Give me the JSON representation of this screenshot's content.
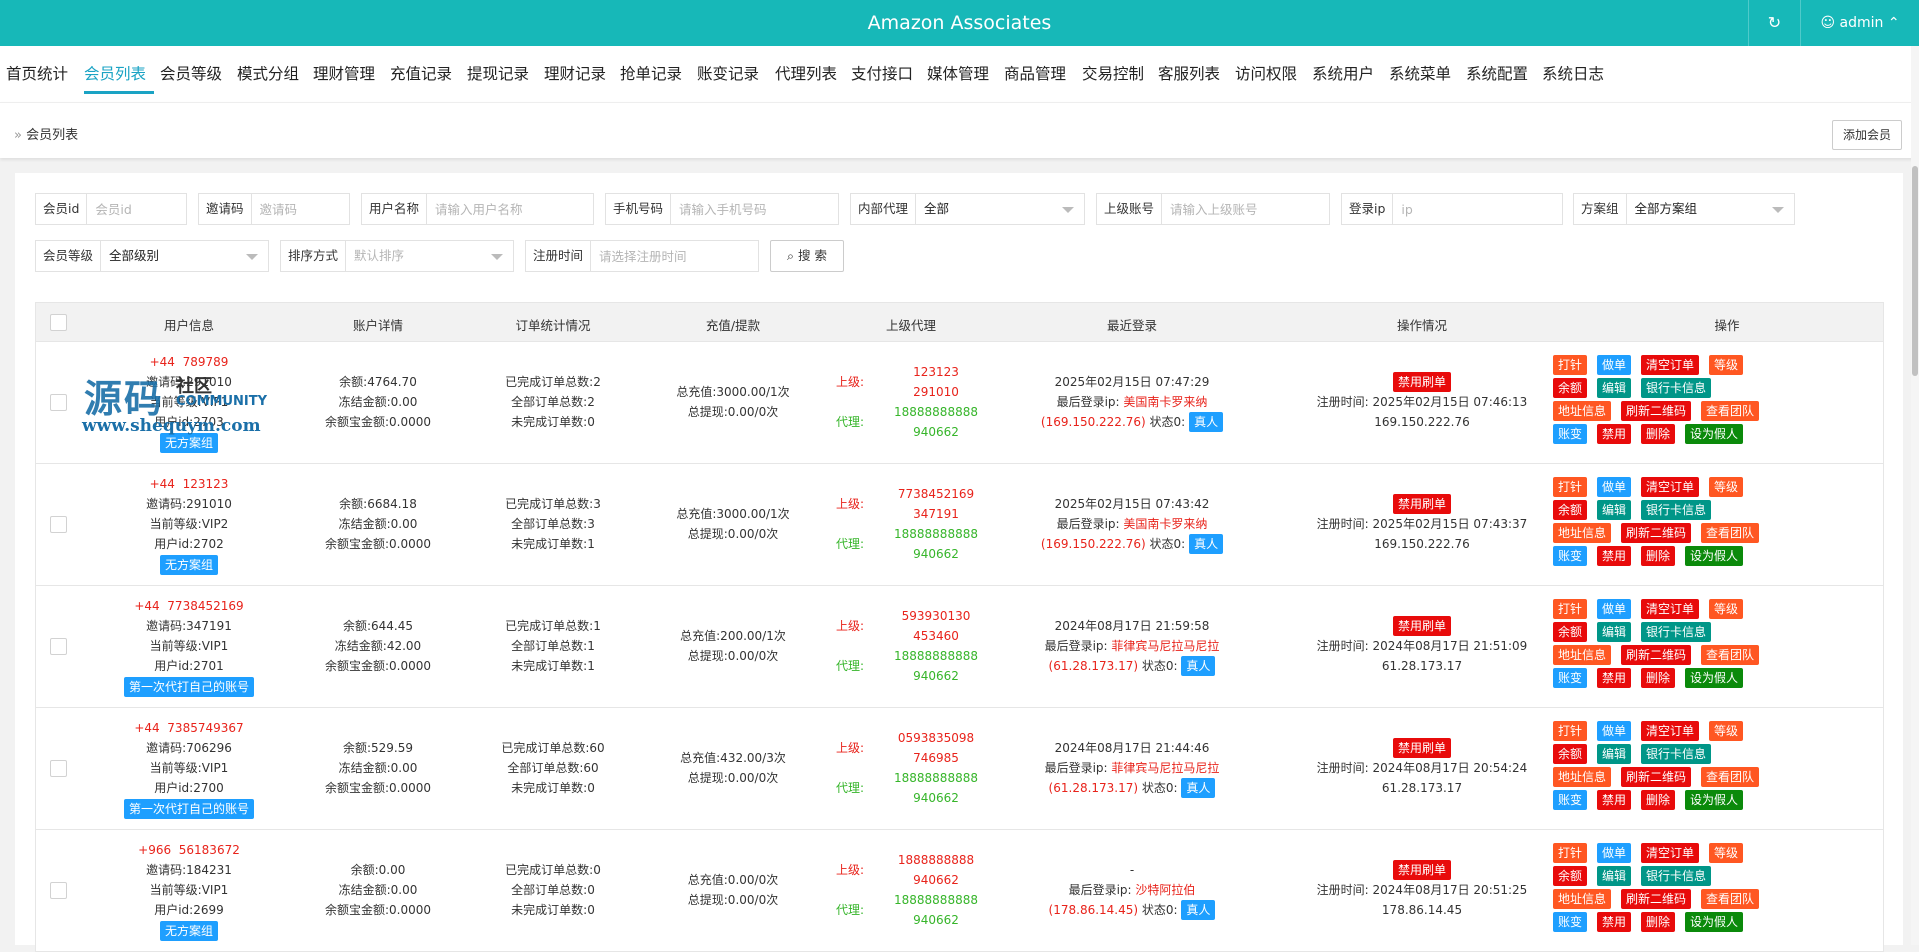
{
  "header": {
    "title": "Amazon Associates",
    "refresh_icon": "refresh-icon",
    "user": "admin"
  },
  "nav": {
    "items": [
      "首页统计",
      "会员列表",
      "会员等级",
      "模式分组",
      "理财管理",
      "充值记录",
      "提现记录",
      "理财记录",
      "抢单记录",
      "账变记录",
      "代理列表",
      "支付接口",
      "媒体管理",
      "商品管理",
      "交易控制",
      "客服列表",
      "访问权限",
      "系统用户",
      "系统菜单",
      "系统配置",
      "系统日志"
    ],
    "active": "会员列表"
  },
  "breadcrumb": {
    "label": "会员列表"
  },
  "add_button": "添加会员",
  "filters": {
    "member_id": {
      "label": "会员id",
      "placeholder": "会员id"
    },
    "invite_code": {
      "label": "邀请码",
      "placeholder": "邀请码"
    },
    "username": {
      "label": "用户名称",
      "placeholder": "请输入用户名称"
    },
    "phone": {
      "label": "手机号码",
      "placeholder": "请输入手机号码"
    },
    "internal_agent": {
      "label": "内部代理",
      "value": "全部"
    },
    "parent_account": {
      "label": "上级账号",
      "placeholder": "请输入上级账号"
    },
    "login_ip": {
      "label": "登录ip",
      "placeholder": "ip"
    },
    "plan_group": {
      "label": "方案组",
      "value": "全部方案组"
    },
    "member_level": {
      "label": "会员等级",
      "value": "全部级别"
    },
    "sort": {
      "label": "排序方式",
      "value": "默认排序"
    },
    "reg_time": {
      "label": "注册时间",
      "placeholder": "请选择注册时间"
    },
    "search_button": "搜 索"
  },
  "table": {
    "headers": [
      "用户信息",
      "账户详情",
      "订单统计情况",
      "充值/提款",
      "上级代理",
      "最近登录",
      "操作情况",
      "操作"
    ],
    "rows": [
      {
        "phone_prefix": "+44",
        "phone": "789789",
        "invite": "邀请码:291010",
        "level": "当前等级:VIP1",
        "uid": "用户id:2703",
        "tag": "无方案组",
        "balance": "余额:4764.70",
        "frozen": "冻结金额:0.00",
        "yuebao": "余额宝金额:0.0000",
        "done": "已完成订单总数:2",
        "total": "全部订单总数:2",
        "undone": "未完成订单数:0",
        "recharge": "总充值:3000.00/1次",
        "withdraw": "总提现:0.00/0次",
        "parent_label": "上级:",
        "parent1": "123123",
        "parent2": "291010",
        "agent_label": "代理:",
        "agent1": "18888888888",
        "agent2": "940662",
        "login_time": "2025年02月15日 07:47:29",
        "login_ip_label": "最后登录ip:",
        "login_loc": "美国南卡罗来纳",
        "login_ip": "(169.150.222.76)",
        "state": "状态0:",
        "state_tag": "真人",
        "ban_tag": "禁用刷单",
        "reg_time": "注册时间: 2025年02月15日 07:46:13",
        "reg_ip": "169.150.222.76"
      },
      {
        "phone_prefix": "+44",
        "phone": "123123",
        "invite": "邀请码:291010",
        "level": "当前等级:VIP2",
        "uid": "用户id:2702",
        "tag": "无方案组",
        "balance": "余额:6684.18",
        "frozen": "冻结金额:0.00",
        "yuebao": "余额宝金额:0.0000",
        "done": "已完成订单总数:3",
        "total": "全部订单总数:3",
        "undone": "未完成订单数:1",
        "recharge": "总充值:3000.00/1次",
        "withdraw": "总提现:0.00/0次",
        "parent_label": "上级:",
        "parent1": "7738452169",
        "parent2": "347191",
        "agent_label": "代理:",
        "agent1": "18888888888",
        "agent2": "940662",
        "login_time": "2025年02月15日 07:43:42",
        "login_ip_label": "最后登录ip:",
        "login_loc": "美国南卡罗来纳",
        "login_ip": "(169.150.222.76)",
        "state": "状态0:",
        "state_tag": "真人",
        "ban_tag": "禁用刷单",
        "reg_time": "注册时间: 2025年02月15日 07:43:37",
        "reg_ip": "169.150.222.76"
      },
      {
        "phone_prefix": "+44",
        "phone": "7738452169",
        "invite": "邀请码:347191",
        "level": "当前等级:VIP1",
        "uid": "用户id:2701",
        "tag": "第一次代打自己的账号",
        "balance": "余额:644.45",
        "frozen": "冻结金额:42.00",
        "yuebao": "余额宝金额:0.0000",
        "done": "已完成订单总数:1",
        "total": "全部订单总数:1",
        "undone": "未完成订单数:1",
        "recharge": "总充值:200.00/1次",
        "withdraw": "总提现:0.00/0次",
        "parent_label": "上级:",
        "parent1": "593930130",
        "parent2": "453460",
        "agent_label": "代理:",
        "agent1": "18888888888",
        "agent2": "940662",
        "login_time": "2024年08月17日 21:59:58",
        "login_ip_label": "最后登录ip:",
        "login_loc": "菲律宾马尼拉马尼拉",
        "login_ip": "(61.28.173.17)",
        "state": "状态0:",
        "state_tag": "真人",
        "ban_tag": "禁用刷单",
        "reg_time": "注册时间: 2024年08月17日 21:51:09",
        "reg_ip": "61.28.173.17"
      },
      {
        "phone_prefix": "+44",
        "phone": "7385749367",
        "invite": "邀请码:706296",
        "level": "当前等级:VIP1",
        "uid": "用户id:2700",
        "tag": "第一次代打自己的账号",
        "balance": "余额:529.59",
        "frozen": "冻结金额:0.00",
        "yuebao": "余额宝金额:0.0000",
        "done": "已完成订单总数:60",
        "total": "全部订单总数:60",
        "undone": "未完成订单数:0",
        "recharge": "总充值:432.00/3次",
        "withdraw": "总提现:0.00/0次",
        "parent_label": "上级:",
        "parent1": "0593835098",
        "parent2": "746985",
        "agent_label": "代理:",
        "agent1": "18888888888",
        "agent2": "940662",
        "login_time": "2024年08月17日 21:44:46",
        "login_ip_label": "最后登录ip:",
        "login_loc": "菲律宾马尼拉马尼拉",
        "login_ip": "(61.28.173.17)",
        "state": "状态0:",
        "state_tag": "真人",
        "ban_tag": "禁用刷单",
        "reg_time": "注册时间: 2024年08月17日 20:54:24",
        "reg_ip": "61.28.173.17"
      },
      {
        "phone_prefix": "+966",
        "phone": "56183672",
        "invite": "邀请码:184231",
        "level": "当前等级:VIP1",
        "uid": "用户id:2699",
        "tag": "无方案组",
        "balance": "余额:0.00",
        "frozen": "冻结金额:0.00",
        "yuebao": "余额宝金额:0.0000",
        "done": "已完成订单总数:0",
        "total": "全部订单总数:0",
        "undone": "未完成订单数:0",
        "recharge": "总充值:0.00/0次",
        "withdraw": "总提现:0.00/0次",
        "parent_label": "上级:",
        "parent1": "1888888888",
        "parent2": "940662",
        "agent_label": "代理:",
        "agent1": "18888888888",
        "agent2": "940662",
        "login_time": "-",
        "login_ip_label": "最后登录ip:",
        "login_loc": "沙特阿拉伯",
        "login_ip": "(178.86.14.45)",
        "state": "状态0:",
        "state_tag": "真人",
        "ban_tag": "禁用刷单",
        "reg_time": "注册时间: 2024年08月17日 20:51:25",
        "reg_ip": "178.86.14.45"
      }
    ],
    "actions": {
      "line1": [
        "打针",
        "做单",
        "清空订单",
        "等级"
      ],
      "line2": [
        "余额",
        "编辑",
        "银行卡信息"
      ],
      "line3": [
        "地址信息",
        "刷新二维码",
        "查看团队"
      ],
      "line4": [
        "账变",
        "禁用",
        "删除",
        "设为假人"
      ]
    }
  },
  "watermark": {
    "text1": "源码",
    "text2": "社区",
    "text3": "COMMUNITY",
    "text4": "www.shequym.com"
  },
  "colors": {
    "topbar": "#17b8b8",
    "active_nav": "#1aa3c4",
    "red": "#e8231b",
    "green": "#36b52a"
  }
}
